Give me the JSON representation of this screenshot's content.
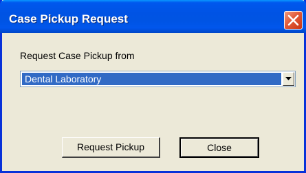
{
  "window": {
    "title": "Case Pickup Request"
  },
  "form": {
    "prompt_label": "Request Case Pickup from",
    "pickup_source": {
      "selected": "Dental Laboratory"
    }
  },
  "buttons": {
    "request_label": "Request Pickup",
    "close_label": "Close"
  },
  "icons": {
    "title_close": "close-icon",
    "dropdown": "chevron-down-icon"
  },
  "colors": {
    "title_bar": "#0054e3",
    "selection": "#316ac5",
    "close_button": "#e25a3a",
    "dialog_background": "#ece9d8"
  }
}
